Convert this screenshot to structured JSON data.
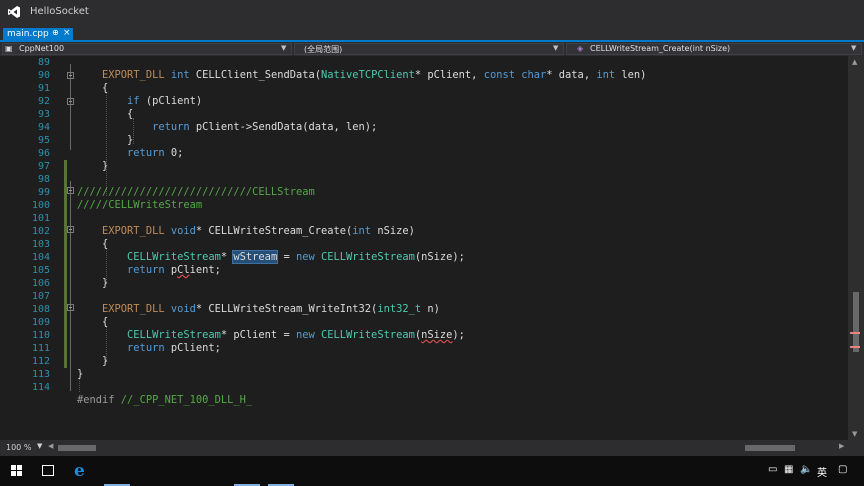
{
  "window": {
    "title": "HelloSocket"
  },
  "tabs": [
    {
      "label": "main.cpp",
      "pin": "⊕",
      "close": "×"
    }
  ],
  "navbar": {
    "project": "CppNet100",
    "scope": "(全局范围)",
    "member_icon": "◈",
    "member": "CELLWriteStream_Create(int nSize)"
  },
  "line_numbers": [
    "89",
    "90",
    "91",
    "92",
    "93",
    "94",
    "95",
    "96",
    "97",
    "98",
    "99",
    "100",
    "101",
    "102",
    "103",
    "104",
    "105",
    "106",
    "107",
    "108",
    "109",
    "110",
    "111",
    "112",
    "113",
    "114"
  ],
  "code": {
    "l89": {
      "macro": "EXPORT_DLL",
      "kw": "int",
      "name": "CELLClient_SendData(",
      "type": "NativeTCPClient",
      "p1": "* pClient, ",
      "kw2": "const",
      "kw3": "char",
      "p2": "* data, ",
      "kw4": "int",
      "p3": " len)"
    },
    "l90": "{",
    "l91": {
      "kw": "if",
      "rest": " (pClient)"
    },
    "l92": "{",
    "l93": {
      "kw": "return",
      "rest": " pClient->SendData(data, len);"
    },
    "l94": "}",
    "l95": {
      "kw": "return",
      "rest": " 0;"
    },
    "l96": "}",
    "l98": "////////////////////////////CELLStream",
    "l99": "/////CELLWriteStream",
    "l101": {
      "macro": "EXPORT_DLL",
      "kw": "void",
      "name": "* CELLWriteStream_Create(",
      "kw2": "int",
      "rest": " nSize)"
    },
    "l102": "{",
    "l103": {
      "type": "CELLWriteStream",
      "p1": "* ",
      "sel": "wStream",
      "p2": " = ",
      "kw": "new",
      "type2": "CELLWriteStream",
      "rest": "(nSize);"
    },
    "l104": {
      "kw": "return",
      "pre": " p",
      "squig": "Cl",
      "rest": "ient;"
    },
    "l105": "}",
    "l107": {
      "macro": "EXPORT_DLL",
      "kw": "void",
      "name": "* CELLWriteStream_WriteInt32(",
      "type": "int32_t",
      "rest": " n)"
    },
    "l108": "{",
    "l109": {
      "type": "CELLWriteStream",
      "p1": "* pClient = ",
      "kw": "new",
      "type2": "CELLWriteStream",
      "pre": "(",
      "squig": "nSize",
      "rest": ");"
    },
    "l110": {
      "kw": "return",
      "rest": " pClient;"
    },
    "l111": "}",
    "l112": "}",
    "l114": {
      "pp": "#endif",
      "cm": " //_CPP_NET_100_DLL_H_"
    }
  },
  "status": {
    "zoom": "100 %"
  },
  "taskbar": {
    "ime": "英",
    "volume_icon": "🔈",
    "notification_icon": "▢"
  },
  "colors": {
    "accent": "#007acc",
    "keyword": "#569cd6",
    "type": "#4ec9b0",
    "comment": "#57a64a",
    "linenumber": "#2b91af",
    "macro": "#be8c5c"
  }
}
